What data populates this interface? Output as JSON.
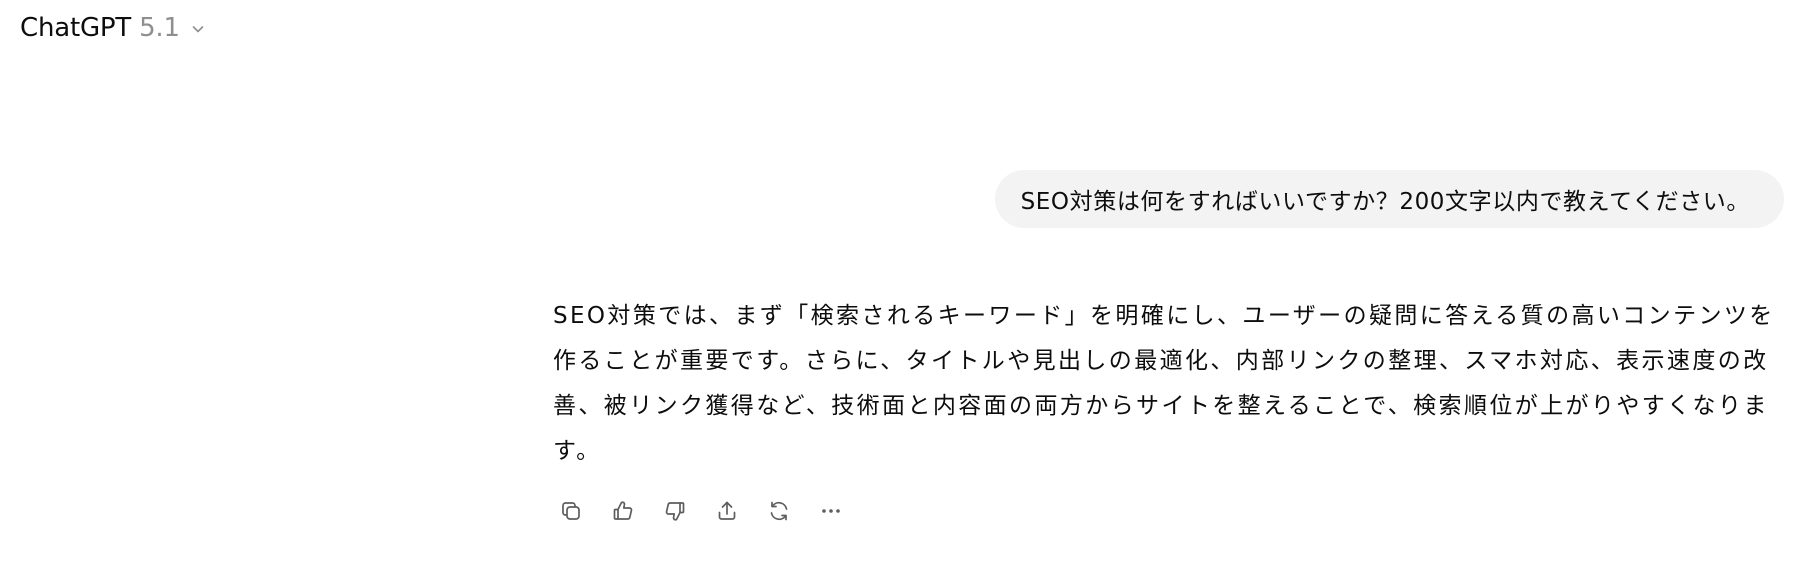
{
  "header": {
    "model_name": "ChatGPT",
    "model_version": "5.1",
    "chevron_icon": "chevron-down-icon"
  },
  "conversation": {
    "user_message": "SEO対策は何をすればいいですか？200文字以内で教えてください。",
    "assistant_message": "SEO対策では、まず「検索されるキーワード」を明確にし、ユーザーの疑問に答える質の高いコンテンツを作ることが重要です。さらに、タイトルや見出しの最適化、内部リンクの整理、スマホ対応、表示速度の改善、被リンク獲得など、技術面と内容面の両方からサイトを整えることで、検索順位が上がりやすくなります。"
  },
  "actions": [
    {
      "icon": "copy-icon"
    },
    {
      "icon": "thumbs-up-icon"
    },
    {
      "icon": "thumbs-down-icon"
    },
    {
      "icon": "share-icon"
    },
    {
      "icon": "regenerate-icon"
    },
    {
      "icon": "more-icon"
    }
  ],
  "colors": {
    "text": "#0d0d0d",
    "muted": "#8f8f8f",
    "bubble": "#f3f3f3",
    "icon": "#5d5d5d"
  }
}
